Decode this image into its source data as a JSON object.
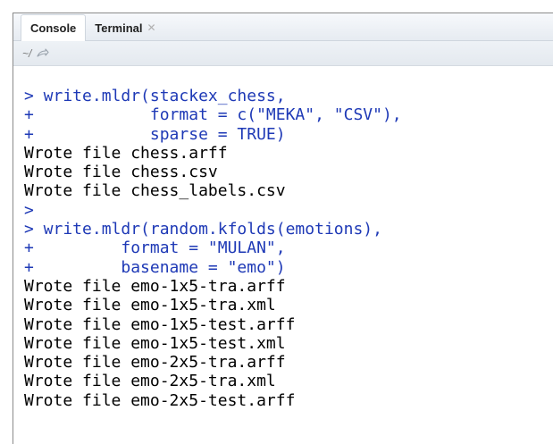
{
  "tabs": [
    {
      "label": "Console",
      "active": true,
      "closable": false
    },
    {
      "label": "Terminal",
      "active": false,
      "closable": true
    }
  ],
  "path": "~/",
  "icons": {
    "close": "close-icon",
    "goto_dir": "go-to-directory-icon"
  },
  "colors": {
    "input": "#1e39b6",
    "output": "#000000"
  },
  "console_lines": [
    {
      "type": "in",
      "text": "> write.mldr(stackex_chess,"
    },
    {
      "type": "in",
      "text": "+            format = c(\"MEKA\", \"CSV\"),"
    },
    {
      "type": "in",
      "text": "+            sparse = TRUE)"
    },
    {
      "type": "out",
      "text": "Wrote file chess.arff"
    },
    {
      "type": "out",
      "text": "Wrote file chess.csv"
    },
    {
      "type": "out",
      "text": "Wrote file chess_labels.csv"
    },
    {
      "type": "in",
      "text": ">"
    },
    {
      "type": "in",
      "text": "> write.mldr(random.kfolds(emotions),"
    },
    {
      "type": "in",
      "text": "+         format = \"MULAN\","
    },
    {
      "type": "in",
      "text": "+         basename = \"emo\")"
    },
    {
      "type": "out",
      "text": "Wrote file emo-1x5-tra.arff"
    },
    {
      "type": "out",
      "text": "Wrote file emo-1x5-tra.xml"
    },
    {
      "type": "out",
      "text": "Wrote file emo-1x5-test.arff"
    },
    {
      "type": "out",
      "text": "Wrote file emo-1x5-test.xml"
    },
    {
      "type": "out",
      "text": "Wrote file emo-2x5-tra.arff"
    },
    {
      "type": "out",
      "text": "Wrote file emo-2x5-tra.xml"
    },
    {
      "type": "out",
      "text": "Wrote file emo-2x5-test.arff"
    }
  ]
}
